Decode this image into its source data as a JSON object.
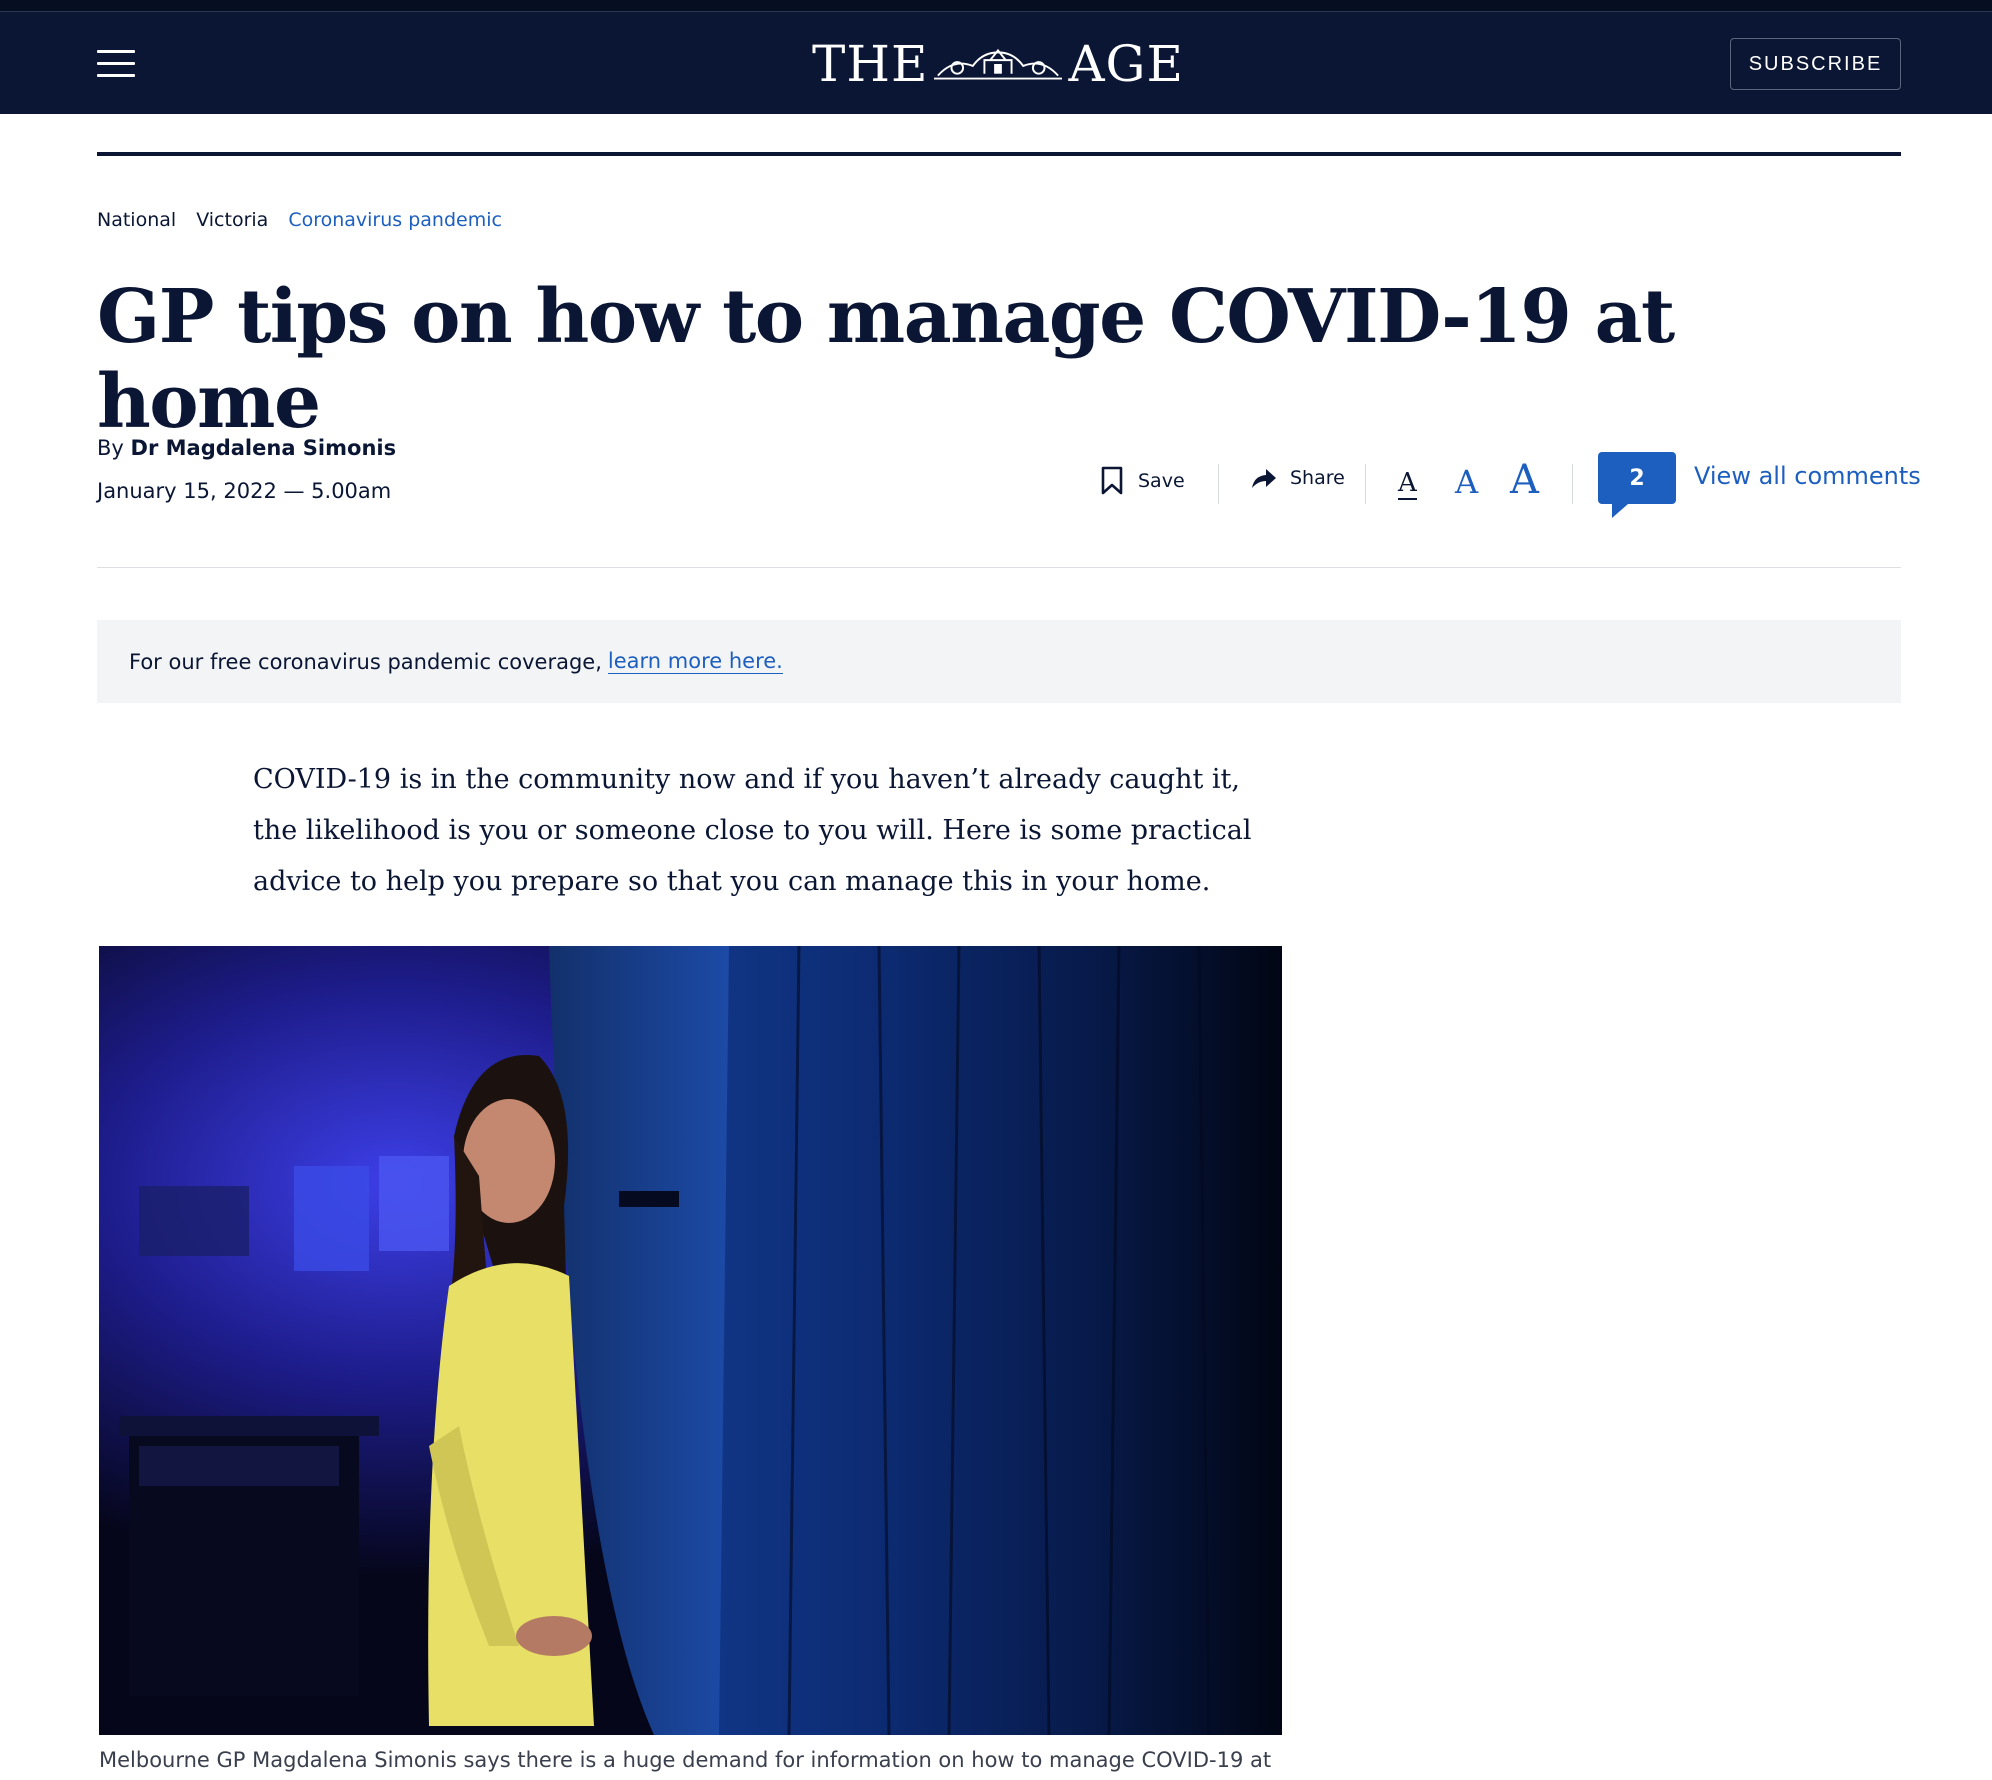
{
  "header": {
    "logo_left": "THE",
    "logo_right": "AGE",
    "subscribe_label": "SUBSCRIBE"
  },
  "breadcrumbs": [
    "National",
    "Victoria",
    "Coronavirus pandemic"
  ],
  "article": {
    "headline": "GP tips on how to manage COVID-19 at home",
    "byline_prefix": "By",
    "author": "Dr Magdalena Simonis",
    "date": "January 15, 2022 — 5.00am",
    "intro": "COVID-19 is in the community now and if you haven’t already caught it, the likelihood is you or someone close to you will. Here is some practical advice to help you prepare so that you can manage this in your home.",
    "caption": "Melbourne GP Magdalena Simonis says there is a huge demand for information on how to manage COVID-19 at"
  },
  "tools": {
    "save_label": "Save",
    "share_label": "Share",
    "font_small": "A",
    "font_medium": "A",
    "font_large": "A",
    "comment_count": "2",
    "view_comments_label": "View all comments"
  },
  "notice": {
    "text": "For our free coronavirus pandemic coverage,",
    "link_text": "learn more here."
  },
  "colors": {
    "brand_navy": "#0a1633",
    "accent_blue": "#1d5fbf",
    "notice_bg": "#f3f4f6"
  },
  "icons": [
    "hamburger-menu-icon",
    "bookmark-icon",
    "share-arrow-icon",
    "comment-bubble-icon"
  ]
}
